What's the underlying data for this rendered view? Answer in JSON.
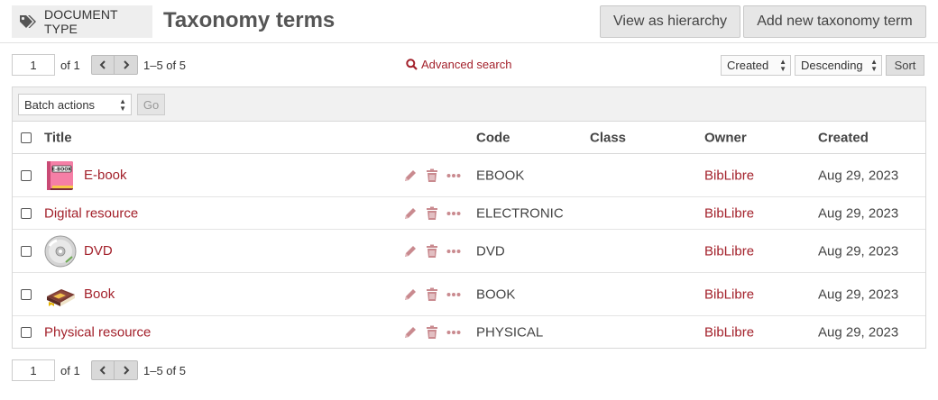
{
  "header": {
    "type_label": "DOCUMENT TYPE",
    "title": "Taxonomy terms",
    "view_hierarchy_label": "View as hierarchy",
    "add_term_label": "Add new taxonomy term"
  },
  "pager": {
    "page_value": "1",
    "of_label": "of 1",
    "range": "1–5 of 5"
  },
  "advanced_search_label": "Advanced search",
  "sort": {
    "field": "Created",
    "direction": "Descending",
    "button_label": "Sort"
  },
  "batch": {
    "select_label": "Batch actions",
    "go_label": "Go"
  },
  "columns": {
    "title": "Title",
    "code": "Code",
    "class": "Class",
    "owner": "Owner",
    "created": "Created"
  },
  "rows": [
    {
      "title": "E-book",
      "code": "EBOOK",
      "class": "",
      "owner": "BibLibre",
      "created": "Aug 29, 2023",
      "icon": "ebook-thumbnail"
    },
    {
      "title": "Digital resource",
      "code": "ELECTRONIC",
      "class": "",
      "owner": "BibLibre",
      "created": "Aug 29, 2023",
      "icon": ""
    },
    {
      "title": "DVD",
      "code": "DVD",
      "class": "",
      "owner": "BibLibre",
      "created": "Aug 29, 2023",
      "icon": "dvd-thumbnail"
    },
    {
      "title": "Book",
      "code": "BOOK",
      "class": "",
      "owner": "BibLibre",
      "created": "Aug 29, 2023",
      "icon": "book-thumbnail"
    },
    {
      "title": "Physical resource",
      "code": "PHYSICAL",
      "class": "",
      "owner": "BibLibre",
      "created": "Aug 29, 2023",
      "icon": ""
    }
  ],
  "colors": {
    "accent": "#a3212b",
    "action_icon": "#c98a8f"
  }
}
